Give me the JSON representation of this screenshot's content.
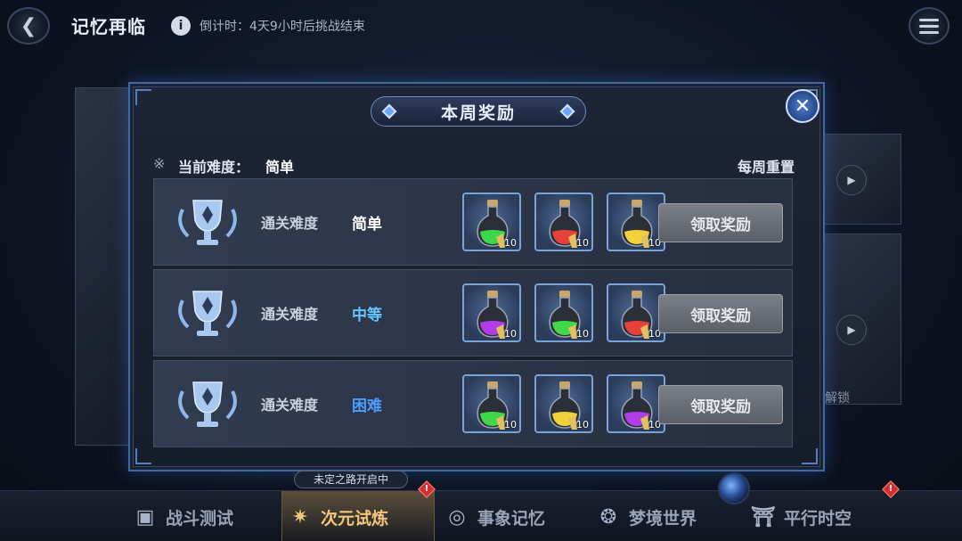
{
  "header": {
    "title": "记忆再临",
    "countdown": "倒计时：4天9小时后挑战结束"
  },
  "background": {
    "unlock_text": "解锁"
  },
  "modal": {
    "title": "本周奖励",
    "current_difficulty_label": "当前难度：",
    "current_difficulty_value": "简单",
    "weekly_reset": "每周重置",
    "rows": [
      {
        "label": "通关难度",
        "difficulty": "简单",
        "difficulty_color": "#ffffff",
        "items": [
          {
            "icon": "green-potion-icon",
            "color": "#3fd84a",
            "qty": "10"
          },
          {
            "icon": "red-potion-icon",
            "color": "#e8413c",
            "qty": "10"
          },
          {
            "icon": "yellow-potion-icon",
            "color": "#f2d23a",
            "qty": "10"
          }
        ],
        "button": "领取奖励"
      },
      {
        "label": "通关难度",
        "difficulty": "中等",
        "difficulty_color": "#66c6ff",
        "items": [
          {
            "icon": "purple-potion-icon",
            "color": "#b13ce8",
            "qty": "10"
          },
          {
            "icon": "green-potion-icon",
            "color": "#3fd84a",
            "qty": "10"
          },
          {
            "icon": "red-potion-icon",
            "color": "#e8413c",
            "qty": "10"
          }
        ],
        "button": "领取奖励"
      },
      {
        "label": "通关难度",
        "difficulty": "困难",
        "difficulty_color": "#4f9bff",
        "items": [
          {
            "icon": "green-potion-icon",
            "color": "#3fd84a",
            "qty": "10"
          },
          {
            "icon": "yellow-potion-icon",
            "color": "#f2d23a",
            "qty": "10"
          },
          {
            "icon": "purple-potion-icon",
            "color": "#b13ce8",
            "qty": "10"
          }
        ],
        "button": "领取奖励"
      }
    ]
  },
  "bottom_nav": {
    "event_pill": "未定之路开启中",
    "items": [
      {
        "label": "战斗测试",
        "icon": "cube-icon",
        "active": false
      },
      {
        "label": "次元试炼",
        "icon": "star-compass-icon",
        "active": true
      },
      {
        "label": "事象记忆",
        "icon": "swirl-icon",
        "active": false
      },
      {
        "label": "梦境世界",
        "icon": "gear-emblem-icon",
        "active": false
      },
      {
        "label": "平行时空",
        "icon": "gate-icon",
        "active": false
      }
    ],
    "alert_mark": "!"
  },
  "colors": {
    "accent": "#3f6aa6",
    "active_tab": "#d6a24a",
    "alert": "#d32f2f"
  }
}
